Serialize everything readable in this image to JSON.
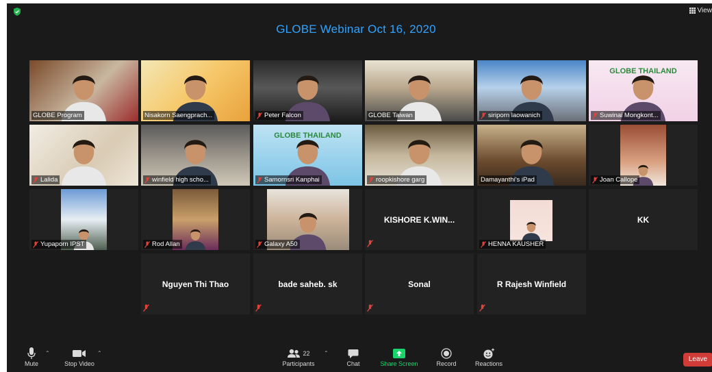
{
  "meeting": {
    "title": "GLOBE Webinar Oct 16, 2020",
    "view_label": "View"
  },
  "participants": [
    {
      "name": "GLOBE Program",
      "muted": false,
      "video": true
    },
    {
      "name": "Nisakorn Saengprach...",
      "muted": false,
      "video": true,
      "active_speaker": true
    },
    {
      "name": "Peter Falcon",
      "muted": true,
      "video": true
    },
    {
      "name": "GLOBE Taiwan",
      "muted": false,
      "video": true
    },
    {
      "name": "siriporn laowanich",
      "muted": true,
      "video": true
    },
    {
      "name": "Suwinai Mongkont...",
      "muted": true,
      "video": true,
      "banner": "GLOBE THAILAND"
    },
    {
      "name": "Lalida",
      "muted": true,
      "video": true
    },
    {
      "name": "winfield high scho...",
      "muted": true,
      "video": true
    },
    {
      "name": "Samornsri Kanphai",
      "muted": true,
      "video": true,
      "banner": "GLOBE THAILAND"
    },
    {
      "name": "roopkishore garg",
      "muted": true,
      "video": true
    },
    {
      "name": "Damayanthi's iPad",
      "muted": false,
      "video": true
    },
    {
      "name": "Joan Callope",
      "muted": true,
      "video": true
    },
    {
      "name": "Yupaporn IPST",
      "muted": true,
      "video": true
    },
    {
      "name": "Rod Allan",
      "muted": true,
      "video": true
    },
    {
      "name": "Galaxy A50",
      "muted": true,
      "video": true
    },
    {
      "name": "KISHORE  K.WIN...",
      "muted": true,
      "video": false
    },
    {
      "name": "HENNA KAUSHER",
      "muted": true,
      "video": true
    },
    {
      "name": "KK",
      "muted": false,
      "video": false
    },
    {
      "name": "Nguyen Thi Thao",
      "muted": true,
      "video": false
    },
    {
      "name": "bade saheb. sk",
      "muted": true,
      "video": false
    },
    {
      "name": "Sonal",
      "muted": true,
      "video": false
    },
    {
      "name": "R Rajesh Winfield",
      "muted": true,
      "video": false
    }
  ],
  "toolbar": {
    "mute_label": "Mute",
    "stop_video_label": "Stop Video",
    "participants_label": "Participants",
    "participants_count": "22",
    "chat_label": "Chat",
    "share_screen_label": "Share Screen",
    "record_label": "Record",
    "reactions_label": "Reactions",
    "leave_label": "Leave"
  },
  "colors": {
    "title": "#30a3ff",
    "active_speaker_border": "#d9e02c",
    "share_screen": "#19d46b",
    "leave": "#d13b38",
    "muted_icon": "#e0433a"
  }
}
